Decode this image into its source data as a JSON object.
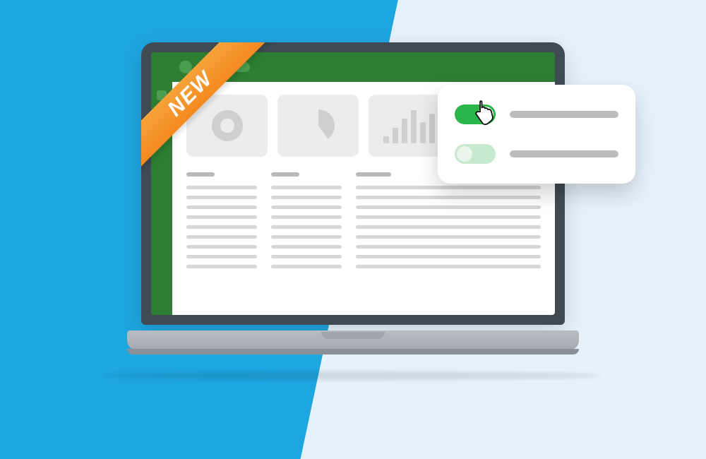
{
  "ribbon": {
    "label": "NEW"
  },
  "colors": {
    "bg_left": "#1ea6e0",
    "bg_right": "#e6f2fb",
    "brand_green": "#2e7d32",
    "toggle_on": "#2ab64a",
    "toggle_off": "#c7e9cf",
    "ribbon": "#f38a1f"
  },
  "dashboard": {
    "cards": [
      {
        "type": "donut"
      },
      {
        "type": "pie"
      },
      {
        "type": "bars"
      },
      {
        "type": "sparkline"
      }
    ],
    "table": {
      "columns": 3,
      "rows": 9
    }
  },
  "popover": {
    "toggles": [
      {
        "state": "on"
      },
      {
        "state": "off"
      }
    ]
  }
}
